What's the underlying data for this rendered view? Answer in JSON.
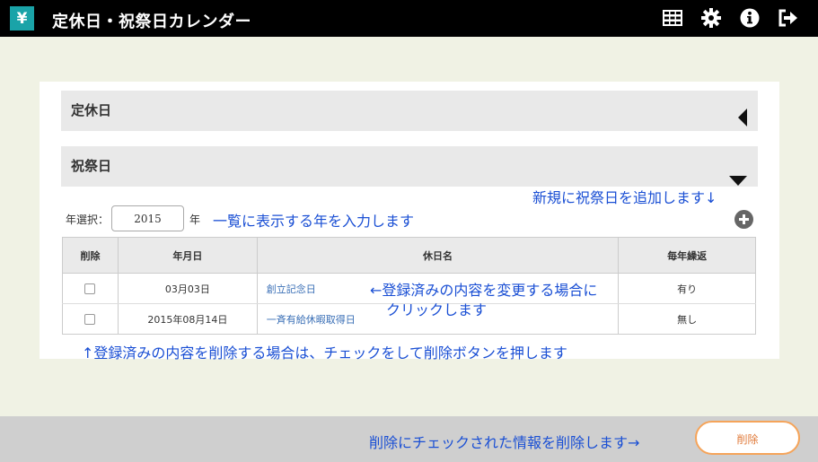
{
  "header": {
    "logo_symbol": "¥",
    "title": "定休日・祝祭日カレンダー",
    "icons": [
      "calendar-grid-icon",
      "gear-icon",
      "info-icon",
      "logout-icon"
    ]
  },
  "sections": {
    "closed_days": "定休日",
    "holidays": "祝祭日"
  },
  "year_select": {
    "label": "年選択：",
    "value": "2015",
    "suffix": "年"
  },
  "annotations": {
    "year_hint": "一覧に表示する年を入力します",
    "add_hint": "新規に祝祭日を追加します↓",
    "edit_hint_line1": "←登録済みの内容を変更する場合に",
    "edit_hint_line2": "クリックします",
    "delete_hint": "↑登録済みの内容を削除する場合は、チェックをして削除ボタンを押します",
    "footer_hint": "削除にチェックされた情報を削除します→"
  },
  "table": {
    "headers": [
      "削除",
      "年月日",
      "休日名",
      "毎年繰返"
    ],
    "rows": [
      {
        "date": "03月03日",
        "name": "創立記念日",
        "repeat": "有り"
      },
      {
        "date": "2015年08月14日",
        "name": "一斉有給休暇取得日",
        "repeat": "無し"
      }
    ]
  },
  "footer": {
    "delete_label": "削除"
  },
  "colors": {
    "topbar": "#000000",
    "logo_bg": "#1aa3a8",
    "background": "#f0f2e4",
    "annotation": "#1a4fd4",
    "link": "#3a6fb6",
    "delete_border": "#f5a45a"
  }
}
